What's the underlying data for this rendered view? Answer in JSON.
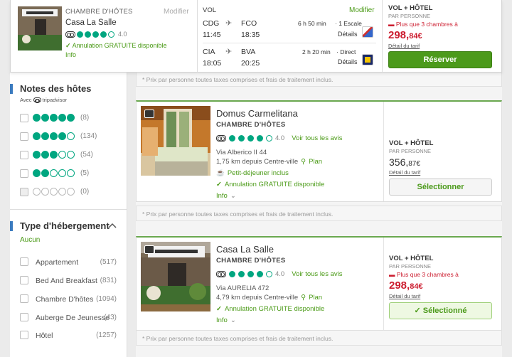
{
  "topbar": {
    "hotel": {
      "type": "CHAMBRE D'HÔTES",
      "modify": "Modifier",
      "name": "Casa La Salle",
      "rating": "4.0",
      "cancellation": "Annulation GRATUITE disponible",
      "info": "Info"
    },
    "flight": {
      "label": "VOL",
      "modify": "Modifier",
      "outbound": {
        "from": "CDG",
        "to": "FCO",
        "dep": "11:45",
        "arr": "18:35",
        "duration": "6 h 50 min",
        "stops": "1 Escale",
        "details": "Détails"
      },
      "inbound": {
        "from": "CIA",
        "to": "BVA",
        "dep": "18:05",
        "arr": "20:25",
        "duration": "2 h 20 min",
        "stops": "Direct",
        "details": "Détails"
      }
    },
    "price": {
      "label": "VOL + HÔTEL",
      "per": "PAR PERSONNE",
      "alert": "Plus que 3 chambres à",
      "amount": "298,",
      "cents": "84",
      "currency": "€",
      "detail": "Détail du tarif",
      "book": "Réserver"
    },
    "note": "* Prix par personne toutes taxes comprises et frais de traitement inclus."
  },
  "sidebar": {
    "ratings_title": "Notes des hôtes",
    "ratings_with": "Avec",
    "ratings_brand": "tripadvisor",
    "ratings": [
      {
        "stars": 5,
        "count": "(8)"
      },
      {
        "stars": 4,
        "count": "(134)"
      },
      {
        "stars": 3,
        "count": "(54)"
      },
      {
        "stars": 2,
        "count": "(5)"
      },
      {
        "stars": 0,
        "count": "(0)"
      }
    ],
    "type_title": "Type d'hébergement",
    "type_none": "Aucun",
    "types": [
      {
        "label": "Appartement",
        "count": "(517)"
      },
      {
        "label": "Bed And Breakfast",
        "count": "(831)"
      },
      {
        "label": "Chambre D'hôtes",
        "count": "(1094)"
      },
      {
        "label": "Auberge De Jeunesse",
        "count": "(43)"
      },
      {
        "label": "Hôtel",
        "count": "(1257)"
      }
    ]
  },
  "listings": [
    {
      "title": "Domus Carmelitana",
      "type": "CHAMBRE D'HÔTES",
      "rating": "4.0",
      "reviews": "Voir tous les avis",
      "address": "Via Alberico II 44",
      "distance": "1,75 km depuis Centre-ville",
      "plan": "Plan",
      "breakfast": "Petit-déjeuner inclus",
      "cancellation": "Annulation GRATUITE disponible",
      "info": "Info",
      "price_label": "VOL + HÔTEL",
      "per": "PAR PERSONNE",
      "amount": "356,",
      "cents": "87",
      "currency": "€",
      "detail": "Détail du tarif",
      "button": "Sélectionner",
      "note": "* Prix par personne toutes taxes comprises et frais de traitement inclus."
    },
    {
      "title": "Casa La Salle",
      "type": "CHAMBRE D'HÔTES",
      "rating": "4.0",
      "reviews": "Voir tous les avis",
      "address": "Via AURELIA 472",
      "distance": "4,79 km depuis Centre-ville",
      "plan": "Plan",
      "cancellation": "Annulation GRATUITE disponible",
      "info": "Info",
      "price_label": "VOL + HÔTEL",
      "per": "PAR PERSONNE",
      "alert": "Plus que 3 chambres à",
      "amount": "298,",
      "cents": "84",
      "currency": "€",
      "detail": "Détail du tarif",
      "button": "Sélectionné",
      "note": "* Prix par personne toutes taxes comprises et frais de traitement inclus."
    }
  ],
  "colors": {
    "accent": "#4c9a1b",
    "price": "#cc1d2f",
    "tripadvisor": "#00a680",
    "marker": "#3b7bbf"
  }
}
